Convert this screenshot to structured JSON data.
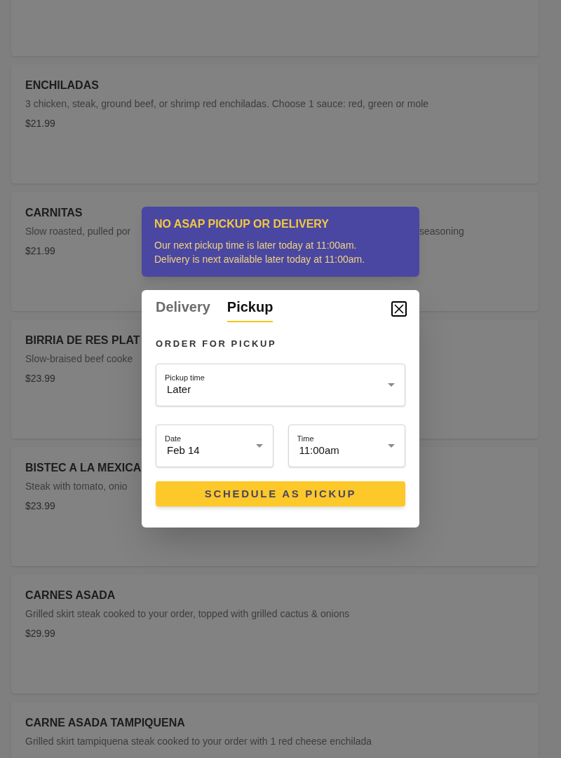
{
  "menu_items": [
    {
      "name": "ENCHILADAS",
      "description": [
        "3 chicken, steak, ground beef, or shrimp red enchiladas. Choose 1 sauce: red, green or mole"
      ],
      "price": "$21.99"
    },
    {
      "name": "CARNITAS",
      "description": [
        "Slow roasted, pulled por",
        "seasoning"
      ],
      "price": "$21.99"
    },
    {
      "name": "BIRRIA DE RES PLAT",
      "description": [
        "Slow-braised beef cooke"
      ],
      "price": "$23.99"
    },
    {
      "name": "BISTEC A LA MEXICA",
      "description": [
        "Steak with tomato, onio"
      ],
      "price": "$23.99"
    },
    {
      "name": "CARNES ASADA",
      "description": [
        "Grilled skirt steak cooked to your order, topped with grilled cactus & onions"
      ],
      "price": "$29.99"
    },
    {
      "name": "CARNE ASADA TAMPIQUENA",
      "description": [
        "Grilled skirt tampiquena steak cooked to your order with 1 red cheese enchilada"
      ]
    }
  ],
  "notice": {
    "title": "NO ASAP PICKUP OR DELIVERY",
    "lines": [
      "Our next pickup time is later today at 11:00am.",
      "Delivery is next available later today at 11:00am."
    ]
  },
  "dialog": {
    "tabs": [
      {
        "label": "Delivery",
        "selected": false
      },
      {
        "label": "Pickup",
        "selected": true
      }
    ],
    "section_title": "ORDER FOR PICKUP",
    "fields": [
      {
        "label": "Pickup time",
        "value": "Later"
      },
      {
        "label": "Date",
        "value": "Feb 14"
      },
      {
        "label": "Time",
        "value": "11:00am"
      }
    ],
    "button": "SCHEDULE AS PICKUP"
  }
}
